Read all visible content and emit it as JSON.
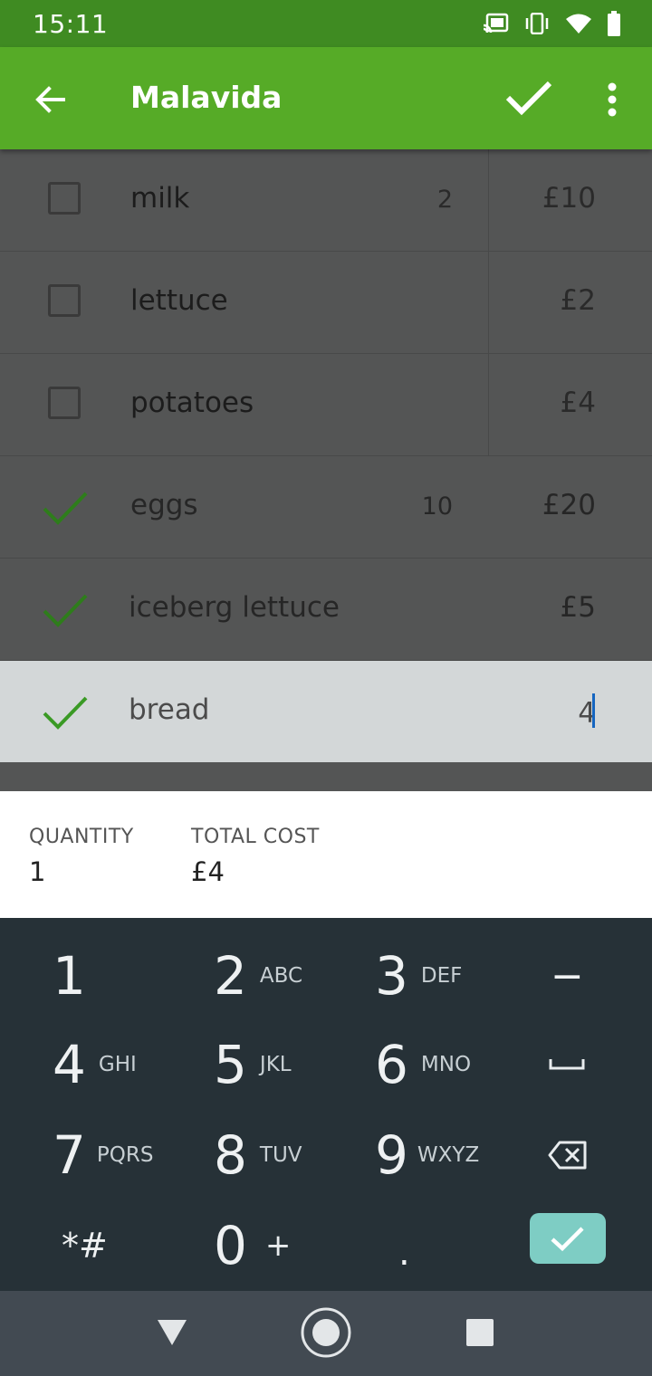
{
  "status": {
    "time": "15:11"
  },
  "appbar": {
    "title": "Malavida"
  },
  "items": [
    {
      "name": "milk",
      "qty": "2",
      "price": "£10",
      "checked": false
    },
    {
      "name": "lettuce",
      "qty": "",
      "price": "£2",
      "checked": false
    },
    {
      "name": "potatoes",
      "qty": "",
      "price": "£4",
      "checked": false
    },
    {
      "name": "eggs",
      "qty": "10",
      "price": "£20",
      "checked": true
    },
    {
      "name": "iceberg lettuce",
      "qty": "",
      "price": "£5",
      "checked": true
    },
    {
      "name": "bread",
      "qty": "",
      "price": "4",
      "checked": true,
      "editing": true
    }
  ],
  "summary": {
    "quantity_label": "QUANTITY",
    "quantity_value": "1",
    "cost_label": "TOTAL COST",
    "cost_value": "£4"
  },
  "keyboard": {
    "keys": [
      {
        "digit": "1",
        "sub": ""
      },
      {
        "digit": "2",
        "sub": "ABC"
      },
      {
        "digit": "3",
        "sub": "DEF"
      },
      {
        "digit": "4",
        "sub": "GHI"
      },
      {
        "digit": "5",
        "sub": "JKL"
      },
      {
        "digit": "6",
        "sub": "MNO"
      },
      {
        "digit": "7",
        "sub": "PQRS"
      },
      {
        "digit": "8",
        "sub": "TUV"
      },
      {
        "digit": "9",
        "sub": "WXYZ"
      },
      {
        "digit": "*#",
        "sub": ""
      },
      {
        "digit": "0",
        "sub": "+"
      },
      {
        "digit": ".",
        "sub": ""
      }
    ],
    "minus_label": "−"
  },
  "colors": {
    "primary": "#56ab27",
    "status": "#3f8b22",
    "keyboard": "#263137",
    "ok_key": "#7ecdc4",
    "check_tick": "#2e7d1b"
  }
}
